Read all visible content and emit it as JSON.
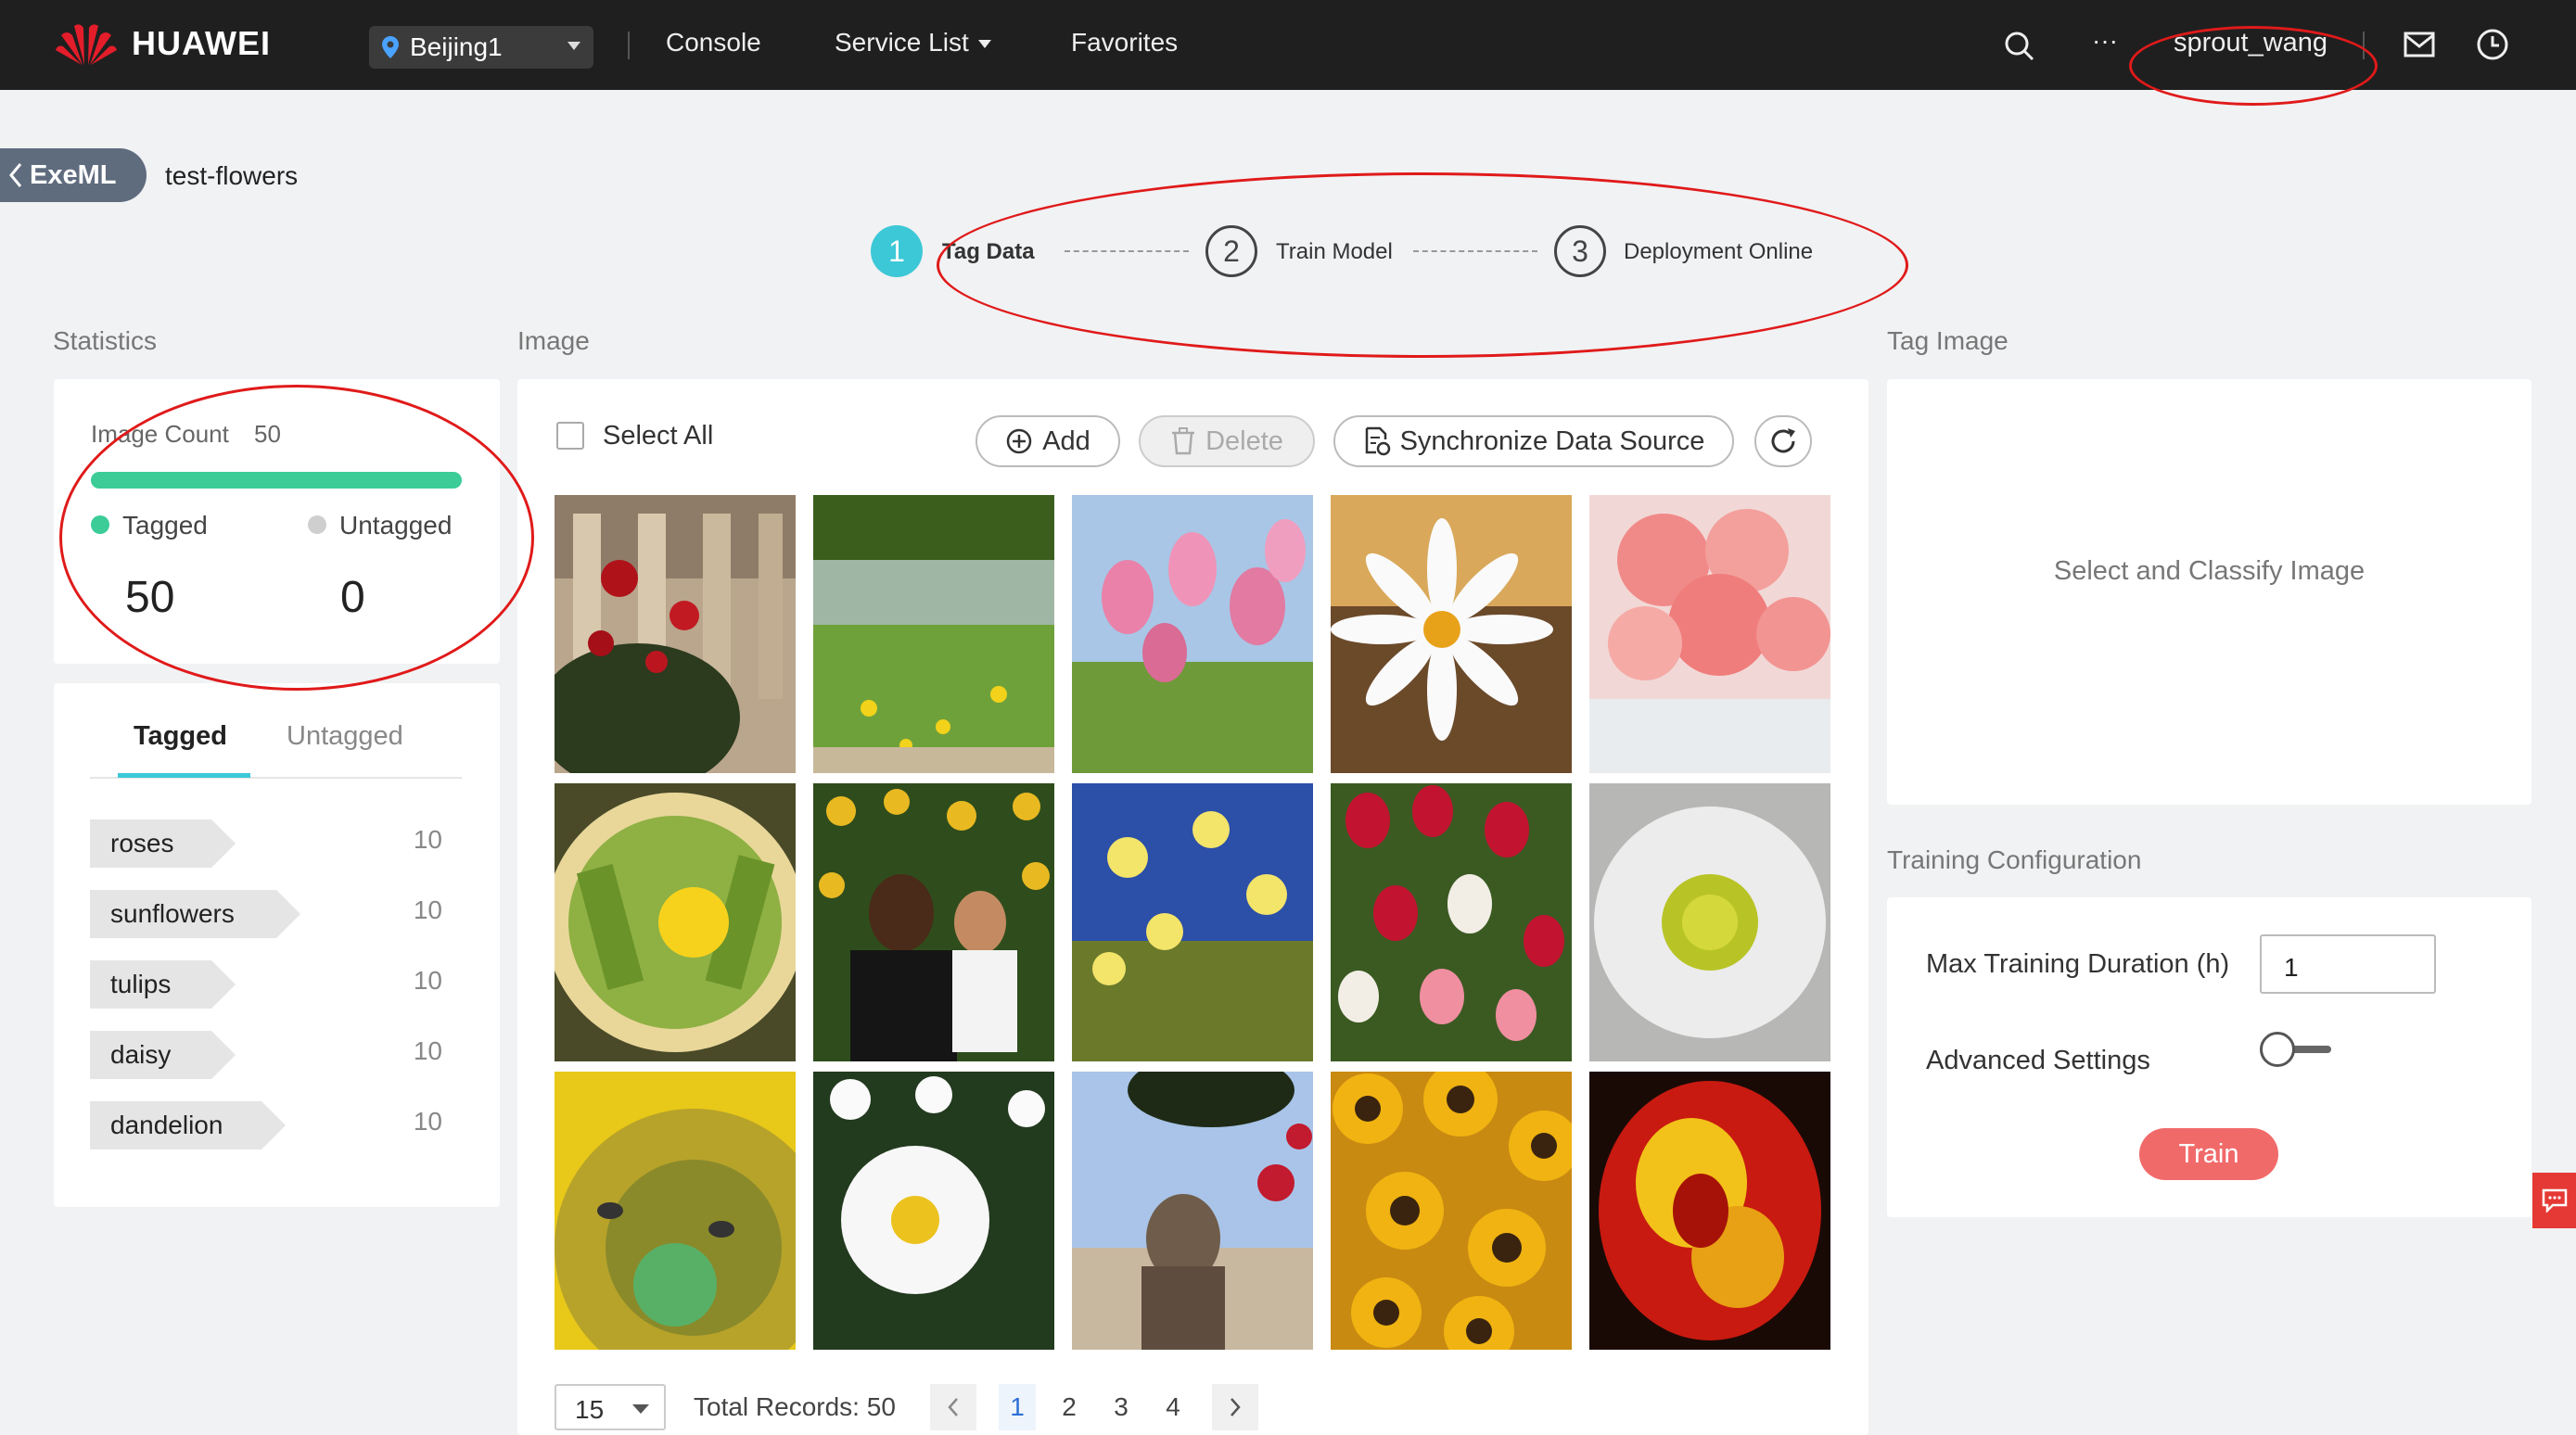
{
  "header": {
    "brand": "HUAWEI",
    "region": "Beijing1",
    "nav": [
      "Console",
      "Service List",
      "Favorites"
    ],
    "more": "···",
    "username": "sprout_wang"
  },
  "breadcrumb": {
    "back_label": "ExeML",
    "project": "test-flowers"
  },
  "steps": [
    {
      "number": "1",
      "label": "Tag Data",
      "active": true
    },
    {
      "number": "2",
      "label": "Train Model",
      "active": false
    },
    {
      "number": "3",
      "label": "Deployment Online",
      "active": false
    }
  ],
  "statistics": {
    "title": "Statistics",
    "image_count_label": "Image Count",
    "image_count": "50",
    "tagged_fraction": 1.0,
    "tagged_label": "Tagged",
    "tagged_count": "50",
    "untagged_label": "Untagged",
    "untagged_count": "0",
    "tabs": [
      "Tagged",
      "Untagged"
    ],
    "labels": [
      {
        "name": "roses",
        "count": "10"
      },
      {
        "name": "sunflowers",
        "count": "10"
      },
      {
        "name": "tulips",
        "count": "10"
      },
      {
        "name": "daisy",
        "count": "10"
      },
      {
        "name": "dandelion",
        "count": "10"
      }
    ]
  },
  "image_panel": {
    "title": "Image",
    "select_all": "Select All",
    "add": "Add",
    "delete": "Delete",
    "sync": "Synchronize Data Source",
    "images": [
      "roses",
      "dandelion",
      "tulips",
      "daisy",
      "roses",
      "dandelion",
      "sunflowers",
      "daisy",
      "tulips",
      "daisy",
      "sunflowers",
      "daisy",
      "roses",
      "sunflowers",
      "tulips"
    ],
    "page_size": "15",
    "total_records": "Total Records: 50",
    "pages": [
      "1",
      "2",
      "3",
      "4"
    ],
    "current_page": "1"
  },
  "tag_image": {
    "title": "Tag Image",
    "placeholder": "Select and Classify Image"
  },
  "training": {
    "title": "Training Configuration",
    "max_duration_label": "Max Training Duration (h)",
    "max_duration_value": "1",
    "advanced_label": "Advanced Settings",
    "advanced_enabled": false,
    "train_button": "Train"
  },
  "colors": {
    "accent": "#3cc8d6",
    "tagged": "#3bcc98",
    "train": "#f16a6a",
    "annotation": "#e01a1a",
    "topbar": "#1f1f1f"
  }
}
